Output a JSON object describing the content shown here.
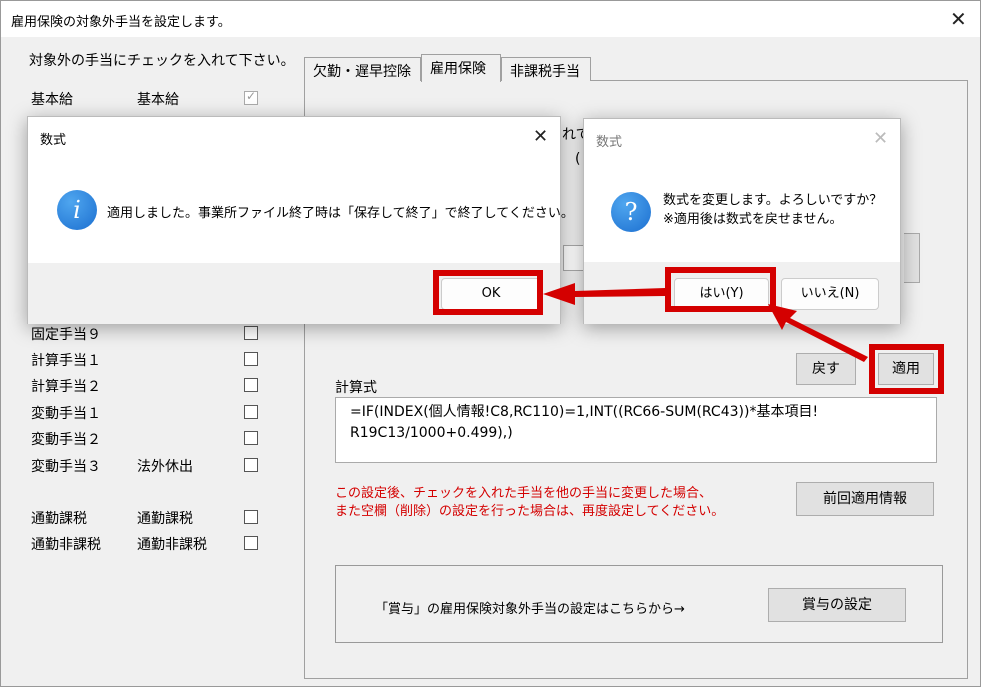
{
  "window": {
    "title": "雇用保険の対象外手当を設定します。",
    "close": "✕"
  },
  "instruction": "対象外の手当にチェックを入れて下さい。",
  "allowance_rows": [
    {
      "name": "基本給",
      "category": "基本給",
      "checked": true
    },
    {
      "name": "固定手当９",
      "category": "",
      "checked": false
    },
    {
      "name": "計算手当１",
      "category": "",
      "checked": false
    },
    {
      "name": "計算手当２",
      "category": "",
      "checked": false
    },
    {
      "name": "変動手当１",
      "category": "",
      "checked": false
    },
    {
      "name": "変動手当２",
      "category": "",
      "checked": false
    },
    {
      "name": "変動手当３",
      "category": "法外休出",
      "checked": false
    },
    {
      "name": "通勤課税",
      "category": "通勤課税",
      "checked": false
    },
    {
      "name": "通勤非課税",
      "category": "通勤非課税",
      "checked": false
    }
  ],
  "tabs": [
    {
      "label": "欠勤・遅早控除",
      "active": false
    },
    {
      "label": "雇用保険",
      "active": true
    },
    {
      "label": "非課税手当",
      "active": false
    }
  ],
  "panel": {
    "back_button": "戻す",
    "apply_button": "適用",
    "formula_label": "計算式",
    "formula_line1": "=IF(INDEX(個人情報!C8,RC110)=1,INT((RC66-SUM(RC43))*基本項目!",
    "formula_line2": "R19C13/1000+0.499),)",
    "warning_line1": "この設定後、チェックを入れた手当を他の手当に変更した場合、",
    "warning_line2": "また空欄（削除）の設定を行った場合は、再度設定してください。",
    "prev_info_button": "前回適用情報",
    "bonus_text": "「賞与」の雇用保険対象外手当の設定はこちらから→",
    "bonus_button": "賞与の設定",
    "hidden_fragment_1": "れて",
    "hidden_fragment_2": "(",
    "hidden_fragment_3": "("
  },
  "dialog_info": {
    "title": "数式",
    "close": "✕",
    "icon": "information-icon",
    "icon_glyph": "i",
    "message": "適用しました。事業所ファイル終了時は「保存して終了」で終了してください。",
    "ok_button": "OK"
  },
  "dialog_confirm": {
    "title": "数式",
    "close": "✕",
    "icon": "question-icon",
    "icon_glyph": "?",
    "message_line1": "数式を変更します。よろしいですか？",
    "message_line2": "※適用後は数式を戻せません。",
    "yes_button": "はい(Y)",
    "no_button": "いいえ(N)"
  },
  "colors": {
    "highlight": "#d40000",
    "warning_text": "#d40000",
    "icon_blue": "#1c6fd0"
  }
}
